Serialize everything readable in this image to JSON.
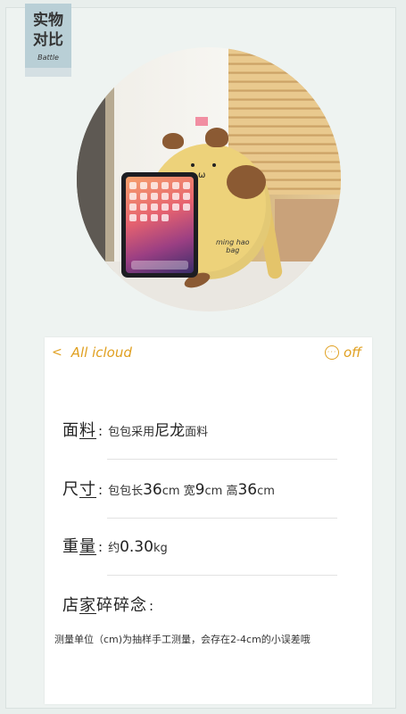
{
  "corner": {
    "title_line1": "实物",
    "title_line2": "对比",
    "subtitle": "Battle"
  },
  "photo": {
    "bag_text_line1": "ming hao",
    "bag_text_line2": "bag",
    "cat_mouth": "ω"
  },
  "card": {
    "back_label": "All icloud",
    "back_icon": "<",
    "more_label": "off",
    "more_icon": "···",
    "accent_color": "#e0a021",
    "rows": [
      {
        "key_a": "面",
        "key_b": "料",
        "colon": ":",
        "val_a": "包包采用",
        "val_b": "尼龙",
        "val_c": "面料"
      },
      {
        "key_a": "尺",
        "key_b": "寸",
        "colon": ":",
        "val_a": "包包长",
        "val_b": "36",
        "val_c": "cm 宽",
        "val_d": "9",
        "val_e": "cm 高",
        "val_f": "36",
        "val_g": "cm"
      },
      {
        "key_a": "重",
        "key_b": "量",
        "colon": ":",
        "val_a": "约",
        "val_b": "0.30",
        "val_c": "kg"
      },
      {
        "key_a": "店",
        "key_b": "家",
        "key_c": "碎碎念",
        "colon": ":"
      }
    ],
    "note": "测量单位（cm)为抽样手工测量，会存在2-4cm的小误差哦"
  }
}
